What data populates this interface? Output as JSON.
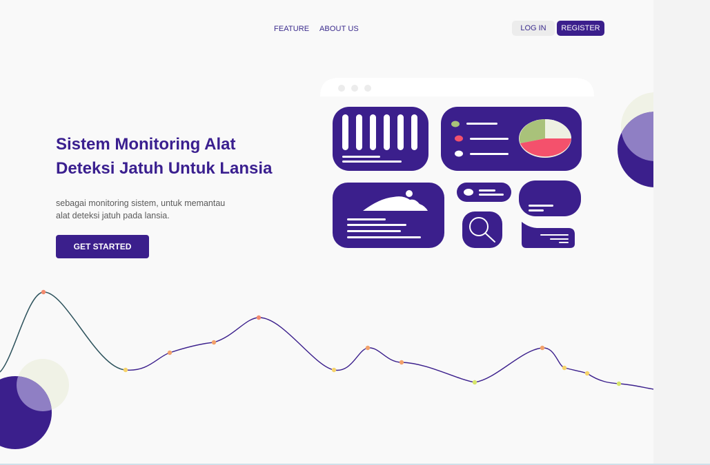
{
  "nav": {
    "links": [
      {
        "label": "FEATURE"
      },
      {
        "label": "ABOUT US"
      }
    ],
    "login_label": "LOG IN",
    "register_label": "REGISTER"
  },
  "hero": {
    "title": "Sistem Monitoring Alat\nDeteksi Jatuh Untuk Lansia",
    "subtitle": "sebagai monitoring sistem, untuk memantau\nalat deteksi jatuh pada lansia.",
    "cta_label": "GET STARTED"
  },
  "colors": {
    "brand": "#3b1f8c",
    "title": "#3a1f8f",
    "background": "#f9f9f9",
    "accent_green": "#a9c27a",
    "accent_red": "#f4516c",
    "dot_orange": "#f2a16b",
    "dot_yellow": "#f6d36a",
    "dot_lime": "#d6e66a"
  },
  "illustration": {
    "icons": [
      "browser-window-icon",
      "bar-columns-icon",
      "pie-chart-icon",
      "image-landscape-icon",
      "search-magnifier-icon",
      "chat-bubble-icon"
    ]
  }
}
